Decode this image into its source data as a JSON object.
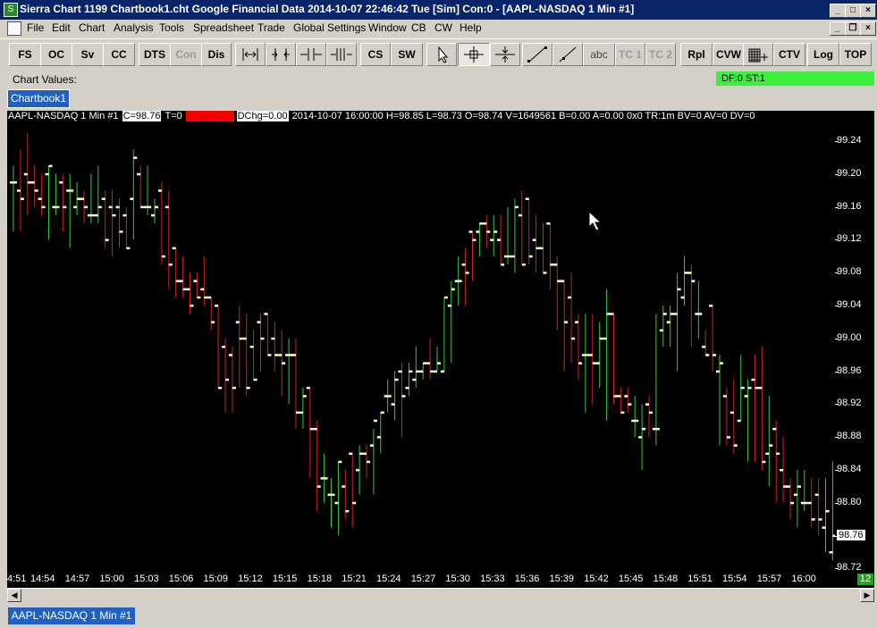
{
  "window": {
    "title": "Sierra Chart 1199 Chartbook1.cht  Google Financial Data 2014-10-07  22:46:42 Tue [Sim]  Con:0 - [AAPL-NASDAQ  1 Min  #1]",
    "app_icon": "chart-icon",
    "buttons": [
      "minimize",
      "maximize",
      "close"
    ]
  },
  "menubar": {
    "items": [
      "File",
      "Edit",
      "Chart",
      "Analysis",
      "Tools",
      "Spreadsheet",
      "Trade",
      "Global Settings",
      "Window",
      "CB",
      "CW",
      "Help"
    ]
  },
  "toolbar": {
    "buttons": [
      {
        "label": "FS"
      },
      {
        "label": "OC"
      },
      {
        "label": "Sv"
      },
      {
        "label": "CC"
      },
      {
        "label": "DTS"
      },
      {
        "label": "Con",
        "disabled": true
      },
      {
        "label": "Dis"
      },
      {
        "icon": "scale-expand-icon"
      },
      {
        "icon": "scale-fit-icon"
      },
      {
        "icon": "bar-spacing-in-icon"
      },
      {
        "icon": "bar-spacing-out-icon"
      },
      {
        "label": "CS"
      },
      {
        "label": "SW"
      },
      {
        "icon": "pointer-icon"
      },
      {
        "icon": "crosshair-icon",
        "pressed": true
      },
      {
        "icon": "value-tool-icon"
      },
      {
        "icon": "line-tool-icon"
      },
      {
        "icon": "ray-tool-icon"
      },
      {
        "label": "abc"
      },
      {
        "label": "TC 1",
        "disabled": true
      },
      {
        "label": "TC 2",
        "disabled": true
      },
      {
        "label": "Rpl"
      },
      {
        "label": "CVW"
      },
      {
        "icon": "tpo-grid-icon"
      },
      {
        "label": "CTV"
      },
      {
        "label": "Log"
      },
      {
        "label": "TOP"
      }
    ]
  },
  "chart_values": {
    "label": "Chart Values:",
    "df_st": "DF:0  ST:1"
  },
  "tabs": [
    "Chartbook1"
  ],
  "infobar": {
    "symbol": "AAPL-NASDAQ  1 Min  #1",
    "close": "C=98.76",
    "ticks": "T=0",
    "chg": "Chg=-0.02",
    "dchg": "DChg=0.00",
    "details": "2014-10-07 16:00:00 H=98.85 L=98.73 O=98.74 V=1649561 B=0.00 A=0.00 0x0 TR:1m BV=0 AV=0 DV=0"
  },
  "colors": {
    "up": "#33cc33",
    "down": "#cc2222",
    "close_tick": "#ffffcc",
    "background": "#000000",
    "axis_text": "#ffffff",
    "chg_highlight": "#ff0000"
  },
  "current_price_label": "98.76",
  "scroll_count": "12",
  "status_tab": "AAPL-NASDAQ  1 Min  #1",
  "chart_data": {
    "type": "ohlc",
    "symbol": "AAPL-NASDAQ",
    "interval": "1 Min",
    "ylim": [
      98.72,
      99.26
    ],
    "y_ticks": [
      "99.24",
      "99.20",
      "99.16",
      "99.12",
      "99.08",
      "99.04",
      "99.00",
      "98.96",
      "98.92",
      "98.88",
      "98.84",
      "98.80",
      "98.76",
      "98.72"
    ],
    "x_ticks": [
      "4:51",
      "14:54",
      "14:57",
      "15:00",
      "15:03",
      "15:06",
      "15:09",
      "15:12",
      "15:15",
      "15:18",
      "15:21",
      "15:24",
      "15:27",
      "15:30",
      "15:33",
      "15:36",
      "15:39",
      "15:42",
      "15:45",
      "15:48",
      "15:51",
      "15:54",
      "15:57",
      "16:00"
    ],
    "bars": [
      {
        "o": 99.19,
        "h": 99.21,
        "l": 99.13,
        "c": 99.19
      },
      {
        "o": 99.18,
        "h": 99.23,
        "l": 99.13,
        "c": 99.17
      },
      {
        "o": 99.2,
        "h": 99.25,
        "l": 99.15,
        "c": 99.19
      },
      {
        "o": 99.19,
        "h": 99.21,
        "l": 99.16,
        "c": 99.18
      },
      {
        "o": 99.17,
        "h": 99.2,
        "l": 99.15,
        "c": 99.16
      },
      {
        "o": 99.2,
        "h": 99.21,
        "l": 99.12,
        "c": 99.21
      },
      {
        "o": 99.16,
        "h": 99.2,
        "l": 99.15,
        "c": 99.16
      },
      {
        "o": 99.19,
        "h": 99.2,
        "l": 99.13,
        "c": 99.16
      },
      {
        "o": 99.18,
        "h": 99.2,
        "l": 99.11,
        "c": 99.18
      },
      {
        "o": 99.16,
        "h": 99.19,
        "l": 99.15,
        "c": 99.17
      },
      {
        "o": 99.17,
        "h": 99.18,
        "l": 99.14,
        "c": 99.16
      },
      {
        "o": 99.15,
        "h": 99.2,
        "l": 99.14,
        "c": 99.15
      },
      {
        "o": 99.15,
        "h": 99.21,
        "l": 99.14,
        "c": 99.16
      },
      {
        "o": 99.17,
        "h": 99.18,
        "l": 99.11,
        "c": 99.12
      },
      {
        "o": 99.16,
        "h": 99.18,
        "l": 99.1,
        "c": 99.15
      },
      {
        "o": 99.16,
        "h": 99.17,
        "l": 99.11,
        "c": 99.13
      },
      {
        "o": 99.15,
        "h": 99.16,
        "l": 99.11,
        "c": 99.11
      },
      {
        "o": 99.17,
        "h": 99.23,
        "l": 99.12,
        "c": 99.22
      },
      {
        "o": 99.2,
        "h": 99.21,
        "l": 99.16,
        "c": 99.16
      },
      {
        "o": 99.16,
        "h": 99.21,
        "l": 99.15,
        "c": 99.16
      },
      {
        "o": 99.15,
        "h": 99.17,
        "l": 99.14,
        "c": 99.16
      },
      {
        "o": 99.18,
        "h": 99.19,
        "l": 99.09,
        "c": 99.1
      },
      {
        "o": 99.16,
        "h": 99.18,
        "l": 99.06,
        "c": 99.09
      },
      {
        "o": 99.11,
        "h": 99.11,
        "l": 99.05,
        "c": 99.07
      },
      {
        "o": 99.07,
        "h": 99.1,
        "l": 99.05,
        "c": 99.06
      },
      {
        "o": 99.06,
        "h": 99.08,
        "l": 99.03,
        "c": 99.04
      },
      {
        "o": 99.07,
        "h": 99.08,
        "l": 99.05,
        "c": 99.05
      },
      {
        "o": 99.06,
        "h": 99.1,
        "l": 99.04,
        "c": 99.05
      },
      {
        "o": 99.05,
        "h": 99.05,
        "l": 99.01,
        "c": 99.02
      },
      {
        "o": 99.04,
        "h": 99.04,
        "l": 98.94,
        "c": 98.94
      },
      {
        "o": 98.99,
        "h": 99.0,
        "l": 98.91,
        "c": 98.95
      },
      {
        "o": 98.98,
        "h": 98.99,
        "l": 98.91,
        "c": 98.94
      },
      {
        "o": 99.02,
        "h": 99.04,
        "l": 98.94,
        "c": 99.0
      },
      {
        "o": 99.0,
        "h": 99.03,
        "l": 98.93,
        "c": 98.94
      },
      {
        "o": 98.99,
        "h": 99.01,
        "l": 98.95,
        "c": 98.95
      },
      {
        "o": 99.02,
        "h": 99.03,
        "l": 98.96,
        "c": 99.0
      },
      {
        "o": 99.03,
        "h": 99.03,
        "l": 98.98,
        "c": 98.98
      },
      {
        "o": 99.0,
        "h": 99.02,
        "l": 98.96,
        "c": 98.98
      },
      {
        "o": 98.98,
        "h": 99.01,
        "l": 98.93,
        "c": 98.97
      },
      {
        "o": 98.98,
        "h": 99.0,
        "l": 98.92,
        "c": 98.98
      },
      {
        "o": 98.98,
        "h": 99.0,
        "l": 98.89,
        "c": 98.91
      },
      {
        "o": 98.91,
        "h": 98.94,
        "l": 98.89,
        "c": 98.93
      },
      {
        "o": 98.94,
        "h": 98.94,
        "l": 98.83,
        "c": 98.89
      },
      {
        "o": 98.89,
        "h": 98.9,
        "l": 98.79,
        "c": 98.82
      },
      {
        "o": 98.83,
        "h": 98.86,
        "l": 98.8,
        "c": 98.83
      },
      {
        "o": 98.81,
        "h": 98.83,
        "l": 98.77,
        "c": 98.81
      },
      {
        "o": 98.8,
        "h": 98.85,
        "l": 98.76,
        "c": 98.85
      },
      {
        "o": 98.82,
        "h": 98.84,
        "l": 98.78,
        "c": 98.79
      },
      {
        "o": 98.86,
        "h": 98.86,
        "l": 98.77,
        "c": 98.8
      },
      {
        "o": 98.84,
        "h": 98.87,
        "l": 98.81,
        "c": 98.86
      },
      {
        "o": 98.86,
        "h": 98.87,
        "l": 98.83,
        "c": 98.85
      },
      {
        "o": 98.87,
        "h": 98.89,
        "l": 98.81,
        "c": 98.9
      },
      {
        "o": 98.88,
        "h": 98.91,
        "l": 98.86,
        "c": 98.91
      },
      {
        "o": 98.93,
        "h": 98.95,
        "l": 98.91,
        "c": 98.93
      },
      {
        "o": 98.92,
        "h": 98.96,
        "l": 98.9,
        "c": 98.95
      },
      {
        "o": 98.96,
        "h": 98.97,
        "l": 98.88,
        "c": 98.93
      },
      {
        "o": 98.94,
        "h": 98.97,
        "l": 98.93,
        "c": 98.96
      },
      {
        "o": 98.95,
        "h": 98.99,
        "l": 98.94,
        "c": 98.96
      },
      {
        "o": 98.96,
        "h": 98.97,
        "l": 98.95,
        "c": 98.97
      },
      {
        "o": 98.97,
        "h": 99.0,
        "l": 98.95,
        "c": 98.96
      },
      {
        "o": 98.96,
        "h": 98.99,
        "l": 98.96,
        "c": 98.97
      },
      {
        "o": 98.96,
        "h": 99.05,
        "l": 98.96,
        "c": 99.05
      },
      {
        "o": 99.04,
        "h": 99.07,
        "l": 98.97,
        "c": 99.06
      },
      {
        "o": 99.07,
        "h": 99.1,
        "l": 99.04,
        "c": 99.07
      },
      {
        "o": 99.09,
        "h": 99.11,
        "l": 99.04,
        "c": 99.08
      },
      {
        "o": 99.13,
        "h": 99.13,
        "l": 99.07,
        "c": 99.12
      },
      {
        "o": 99.13,
        "h": 99.14,
        "l": 99.1,
        "c": 99.14
      },
      {
        "o": 99.14,
        "h": 99.15,
        "l": 99.11,
        "c": 99.13
      },
      {
        "o": 99.12,
        "h": 99.15,
        "l": 99.1,
        "c": 99.13
      },
      {
        "o": 99.12,
        "h": 99.15,
        "l": 99.09,
        "c": 99.09
      },
      {
        "o": 99.1,
        "h": 99.16,
        "l": 99.09,
        "c": 99.1
      },
      {
        "o": 99.1,
        "h": 99.17,
        "l": 99.08,
        "c": 99.16
      },
      {
        "o": 99.15,
        "h": 99.18,
        "l": 99.09,
        "c": 99.09
      },
      {
        "o": 99.17,
        "h": 99.17,
        "l": 99.09,
        "c": 99.1
      },
      {
        "o": 99.12,
        "h": 99.15,
        "l": 99.08,
        "c": 99.11
      },
      {
        "o": 99.11,
        "h": 99.14,
        "l": 99.08,
        "c": 99.08
      },
      {
        "o": 99.14,
        "h": 99.14,
        "l": 99.06,
        "c": 99.09
      },
      {
        "o": 99.09,
        "h": 99.1,
        "l": 99.01,
        "c": 99.07
      },
      {
        "o": 99.07,
        "h": 99.07,
        "l": 98.96,
        "c": 99.02
      },
      {
        "o": 99.05,
        "h": 99.08,
        "l": 98.97,
        "c": 99.0
      },
      {
        "o": 99.02,
        "h": 99.03,
        "l": 98.95,
        "c": 98.97
      },
      {
        "o": 98.98,
        "h": 99.03,
        "l": 98.91,
        "c": 98.98
      },
      {
        "o": 98.98,
        "h": 99.03,
        "l": 98.92,
        "c": 98.97
      },
      {
        "o": 98.97,
        "h": 99.02,
        "l": 98.94,
        "c": 99.0
      },
      {
        "o": 99.0,
        "h": 99.06,
        "l": 98.9,
        "c": 99.03
      },
      {
        "o": 99.03,
        "h": 99.03,
        "l": 98.92,
        "c": 98.93
      },
      {
        "o": 98.93,
        "h": 98.94,
        "l": 98.91,
        "c": 98.91
      },
      {
        "o": 98.93,
        "h": 98.94,
        "l": 98.91,
        "c": 98.92
      },
      {
        "o": 98.9,
        "h": 98.93,
        "l": 98.88,
        "c": 98.9
      },
      {
        "o": 98.88,
        "h": 98.92,
        "l": 98.84,
        "c": 98.89
      },
      {
        "o": 98.92,
        "h": 98.93,
        "l": 98.88,
        "c": 98.91
      },
      {
        "o": 98.89,
        "h": 99.03,
        "l": 98.87,
        "c": 98.89
      },
      {
        "o": 99.01,
        "h": 99.04,
        "l": 98.99,
        "c": 99.03
      },
      {
        "o": 99.02,
        "h": 99.04,
        "l": 98.99,
        "c": 99.03
      },
      {
        "o": 99.03,
        "h": 99.08,
        "l": 98.96,
        "c": 99.06
      },
      {
        "o": 99.05,
        "h": 99.1,
        "l": 99.04,
        "c": 99.08
      },
      {
        "o": 99.08,
        "h": 99.09,
        "l": 98.99,
        "c": 99.07
      },
      {
        "o": 99.03,
        "h": 99.07,
        "l": 99.0,
        "c": 99.03
      },
      {
        "o": 98.99,
        "h": 99.01,
        "l": 98.98,
        "c": 98.98
      },
      {
        "o": 99.04,
        "h": 99.04,
        "l": 98.96,
        "c": 98.98
      },
      {
        "o": 98.96,
        "h": 98.98,
        "l": 98.87,
        "c": 98.97
      },
      {
        "o": 98.93,
        "h": 98.94,
        "l": 98.87,
        "c": 98.88
      },
      {
        "o": 98.91,
        "h": 98.95,
        "l": 98.86,
        "c": 98.87
      },
      {
        "o": 98.9,
        "h": 98.98,
        "l": 98.9,
        "c": 98.94
      },
      {
        "o": 98.93,
        "h": 98.95,
        "l": 98.85,
        "c": 98.94
      },
      {
        "o": 98.95,
        "h": 98.98,
        "l": 98.85,
        "c": 98.94
      },
      {
        "o": 98.94,
        "h": 98.99,
        "l": 98.84,
        "c": 98.85
      },
      {
        "o": 98.86,
        "h": 98.93,
        "l": 98.82,
        "c": 98.87
      },
      {
        "o": 98.89,
        "h": 98.9,
        "l": 98.8,
        "c": 98.86
      },
      {
        "o": 98.84,
        "h": 98.88,
        "l": 98.8,
        "c": 98.82
      },
      {
        "o": 98.82,
        "h": 98.83,
        "l": 98.78,
        "c": 98.8
      },
      {
        "o": 98.81,
        "h": 98.84,
        "l": 98.77,
        "c": 98.82
      },
      {
        "o": 98.8,
        "h": 98.84,
        "l": 98.79,
        "c": 98.8
      },
      {
        "o": 98.8,
        "h": 98.83,
        "l": 98.77,
        "c": 98.78
      },
      {
        "o": 98.81,
        "h": 98.83,
        "l": 98.76,
        "c": 98.78
      },
      {
        "o": 98.77,
        "h": 98.83,
        "l": 98.74,
        "c": 98.79
      },
      {
        "o": 98.74,
        "h": 98.85,
        "l": 98.73,
        "c": 98.76
      },
      {
        "o": 98.74,
        "h": 98.82,
        "l": 98.74,
        "c": 98.76
      }
    ]
  }
}
